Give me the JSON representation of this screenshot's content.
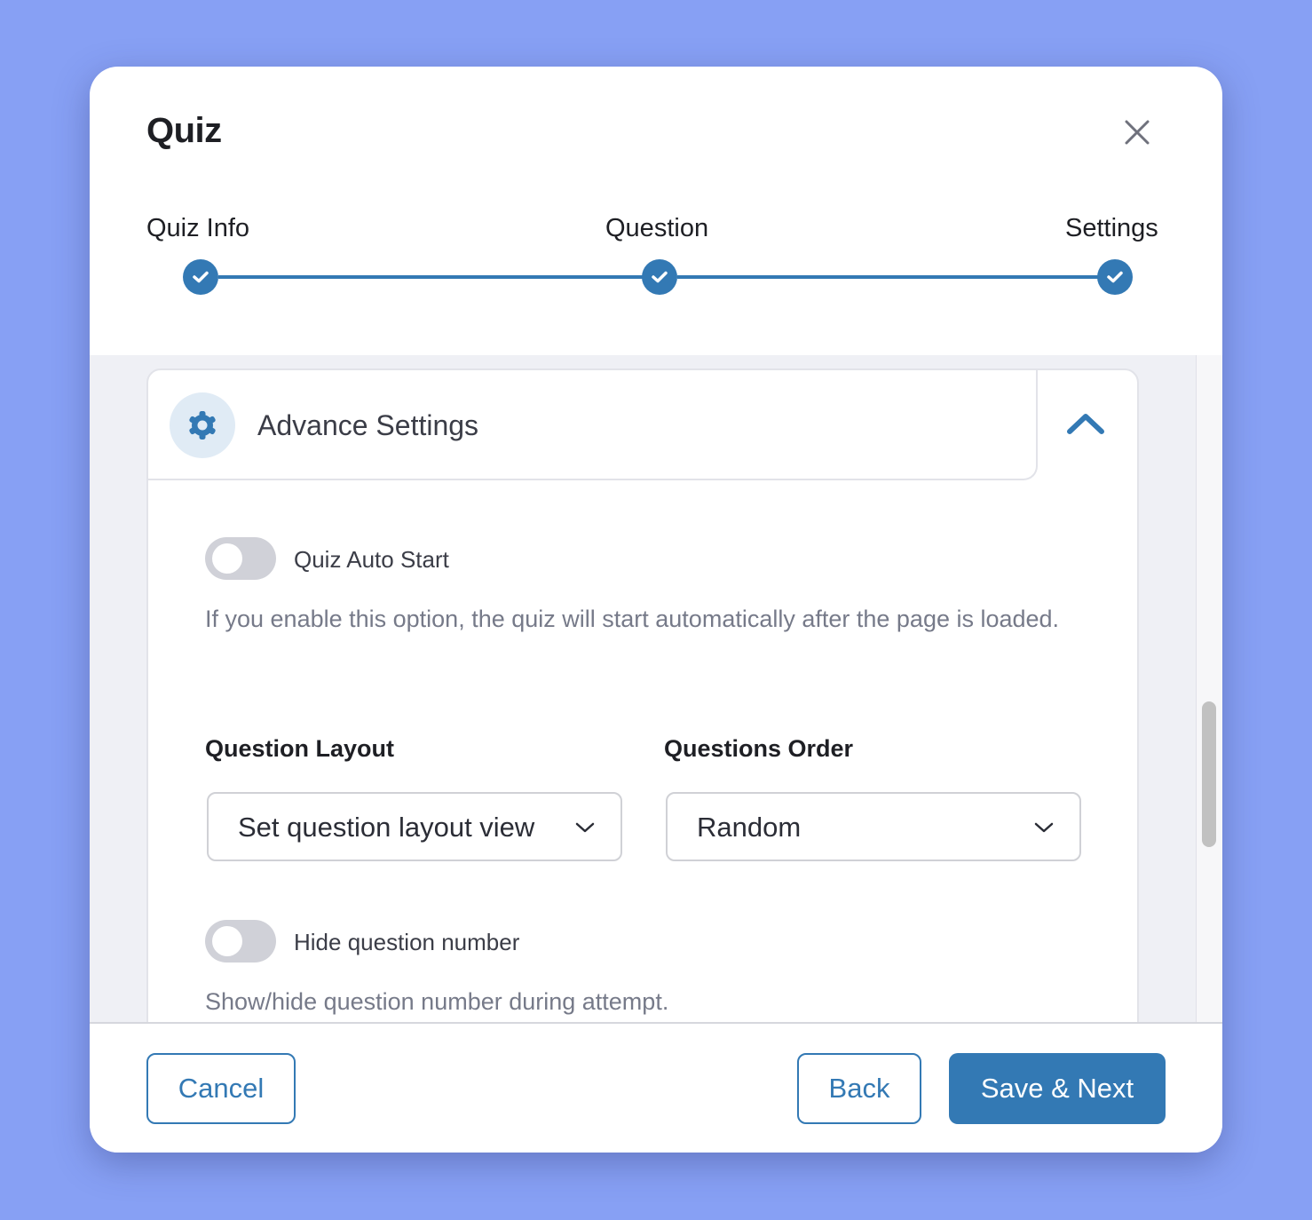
{
  "modal": {
    "title": "Quiz",
    "close_icon": "close-icon"
  },
  "stepper": {
    "steps": [
      {
        "label": "Quiz Info",
        "status": "completed",
        "icon": "check-icon"
      },
      {
        "label": "Question",
        "status": "completed",
        "icon": "check-icon"
      },
      {
        "label": "Settings",
        "status": "completed",
        "icon": "check-icon"
      }
    ],
    "accent_color": "#3379b4"
  },
  "section": {
    "title": "Advance Settings",
    "icon": "gear-icon",
    "expanded": true,
    "collapse_icon": "chevron-up-icon"
  },
  "settings": {
    "auto_start": {
      "label": "Quiz Auto Start",
      "enabled": false,
      "help": "If you enable this option, the quiz will start automatically after the page is loaded."
    },
    "question_layout": {
      "label": "Question Layout",
      "value": "Set question layout view"
    },
    "questions_order": {
      "label": "Questions Order",
      "value": "Random"
    },
    "hide_question_number": {
      "label": "Hide question number",
      "enabled": false,
      "help": "Show/hide question number during attempt."
    }
  },
  "footer": {
    "cancel_label": "Cancel",
    "back_label": "Back",
    "save_next_label": "Save & Next"
  },
  "colors": {
    "primary": "#3379b4",
    "background": "#87a0f4",
    "toggle_off": "#d0d1d8"
  }
}
